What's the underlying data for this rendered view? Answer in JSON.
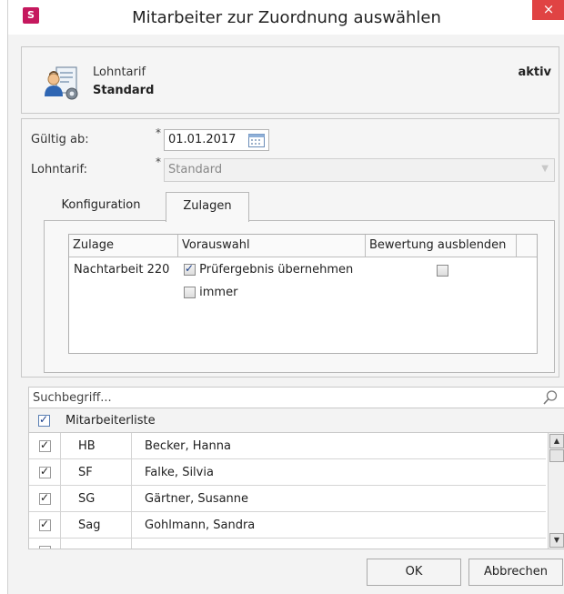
{
  "window": {
    "title": "Mitarbeiter zur Zuordnung auswählen",
    "app_icon_letter": "S",
    "close_glyph": "×"
  },
  "header": {
    "line1": "Lohntarif",
    "line2": "Standard",
    "status": "aktiv",
    "icon": "employee-settings-icon"
  },
  "form": {
    "valid_from_label": "Gültig ab:",
    "valid_from_value": "01.01.2017",
    "tariff_label": "Lohntarif:",
    "tariff_value": "Standard",
    "required_marker": "*"
  },
  "tabs": [
    {
      "label": "Konfiguration",
      "active": false
    },
    {
      "label": "Zulagen",
      "active": true
    }
  ],
  "allowances_grid": {
    "columns": [
      "Zulage",
      "Vorauswahl",
      "Bewertung ausblenden"
    ],
    "rows": [
      {
        "zulage": "Nachtarbeit 220",
        "option1": {
          "label": "Prüfergebnis übernehmen",
          "checked": true
        },
        "option2": {
          "label": "immer",
          "checked": false
        },
        "hide_rating": false
      }
    ]
  },
  "search": {
    "placeholder": "Suchbegriff..."
  },
  "employee_list": {
    "header_label": "Mitarbeiterliste",
    "all_checked": true,
    "rows": [
      {
        "code": "HB",
        "name": "Becker, Hanna",
        "checked": true
      },
      {
        "code": "SF",
        "name": "Falke, Silvia",
        "checked": true
      },
      {
        "code": "SG",
        "name": "Gärtner, Susanne",
        "checked": true
      },
      {
        "code": "Sag",
        "name": "Gohlmann, Sandra",
        "checked": true
      }
    ]
  },
  "buttons": {
    "ok": "OK",
    "cancel": "Abbrechen"
  },
  "colors": {
    "app_icon": "#c5185e",
    "close_button": "#e04343",
    "checkmark": "#1b3f8a"
  }
}
